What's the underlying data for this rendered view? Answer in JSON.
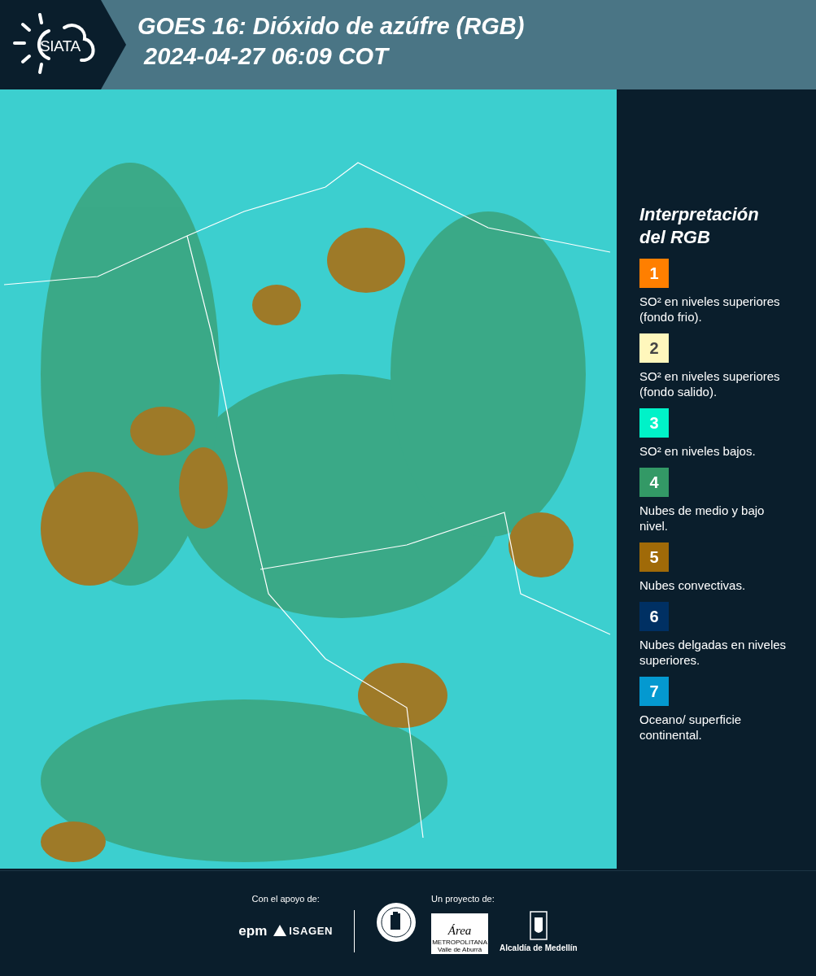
{
  "header": {
    "logo_text": "SIATA",
    "title": "GOES 16: Dióxido de azúfre (RGB)",
    "timestamp": "2024-04-27 06:09 COT"
  },
  "legend": {
    "title": "Interpretación del RGB",
    "items": [
      {
        "number": "1",
        "color": "#ff7f00",
        "text": "SO² en niveles superiores (fondo frio)."
      },
      {
        "number": "2",
        "color": "#fff7bc",
        "text": "SO² en niveles superiores (fondo salido)."
      },
      {
        "number": "3",
        "color": "#00f2c8",
        "text": "SO² en niveles bajos."
      },
      {
        "number": "4",
        "color": "#339966",
        "text": "Nubes de medio y bajo nivel."
      },
      {
        "number": "5",
        "color": "#a06a08",
        "text": "Nubes convectivas."
      },
      {
        "number": "6",
        "color": "#003063",
        "text": "Nubes delgadas en niveles superiores."
      },
      {
        "number": "7",
        "color": "#0499d0",
        "text": "Oceano/ superficie continental."
      }
    ]
  },
  "footer": {
    "support_label": "Con el apoyo de:",
    "support_logos": [
      "epm",
      "ISAGEN"
    ],
    "project_label": "Un proyecto de:",
    "area_logo": {
      "name": "Área",
      "line1": "METROPOLITANA",
      "line2": "Valle de Aburrá"
    },
    "alcaldia_label": "Alcaldía de Medellín"
  }
}
